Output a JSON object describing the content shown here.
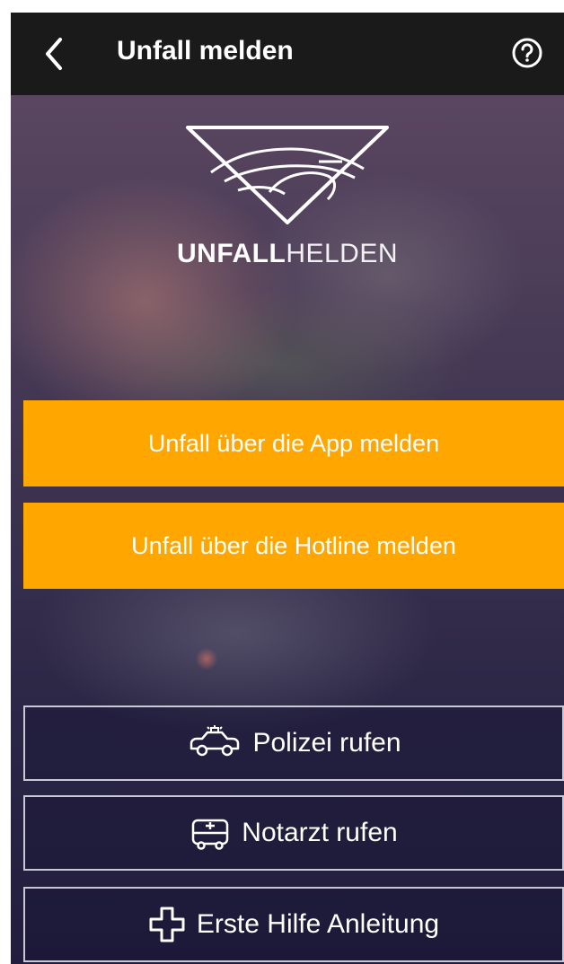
{
  "header": {
    "title": "Unfall melden",
    "back_icon": "chevron-left-icon",
    "help_icon": "question-circle-icon"
  },
  "logo": {
    "text_bold": "UNFALL",
    "text_light": "HELDEN"
  },
  "actions": {
    "app_report_label": "Unfall über die App melden",
    "hotline_report_label": "Unfall über die Hotline melden",
    "police_label": "Polizei rufen",
    "emergency_doctor_label": "Notarzt rufen",
    "first_aid_label": "Erste Hilfe Anleitung"
  },
  "colors": {
    "accent": "#ffa600",
    "topbar": "#1a1a1a",
    "background": "#2c2746"
  }
}
